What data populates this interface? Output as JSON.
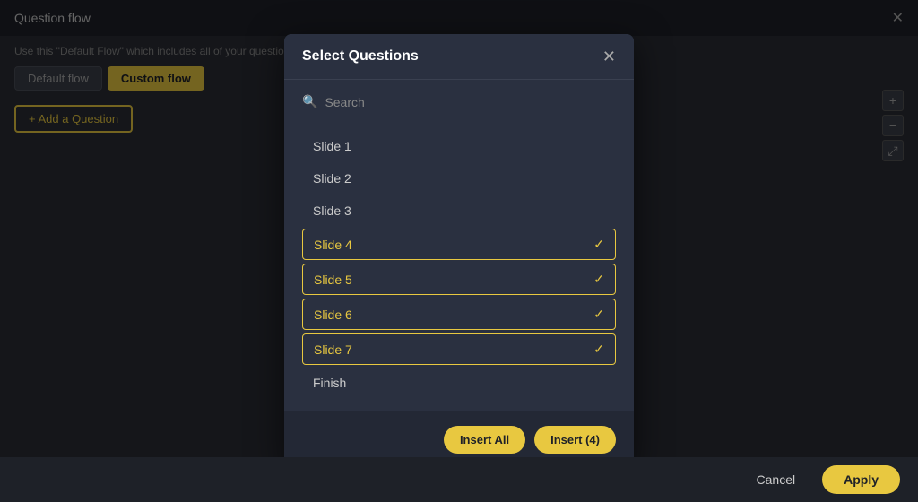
{
  "page": {
    "title": "Question flow",
    "close_label": "✕"
  },
  "bg": {
    "subtitle": "Use this \"Default Flow\" which includes all of your questions in basic for y...",
    "tabs": [
      {
        "id": "default",
        "label": "Default flow",
        "active": false
      },
      {
        "id": "custom",
        "label": "Custom flow",
        "active": true
      }
    ],
    "add_button_label": "+ Add a Question"
  },
  "zoom": {
    "plus_label": "+",
    "minus_label": "−",
    "fit_label": "⤢"
  },
  "modal": {
    "title": "Select Questions",
    "close_label": "✕",
    "search_placeholder": "Search",
    "slides": [
      {
        "id": "slide1",
        "label": "Slide 1",
        "selected": false
      },
      {
        "id": "slide2",
        "label": "Slide 2",
        "selected": false
      },
      {
        "id": "slide3",
        "label": "Slide 3",
        "selected": false
      },
      {
        "id": "slide4",
        "label": "Slide 4",
        "selected": true
      },
      {
        "id": "slide5",
        "label": "Slide 5",
        "selected": true
      },
      {
        "id": "slide6",
        "label": "Slide 6",
        "selected": true
      },
      {
        "id": "slide7",
        "label": "Slide 7",
        "selected": true
      },
      {
        "id": "finish",
        "label": "Finish",
        "selected": false
      }
    ],
    "insert_all_label": "Insert All",
    "insert_label": "Insert (4)"
  },
  "bottom_bar": {
    "cancel_label": "Cancel",
    "apply_label": "Apply"
  }
}
